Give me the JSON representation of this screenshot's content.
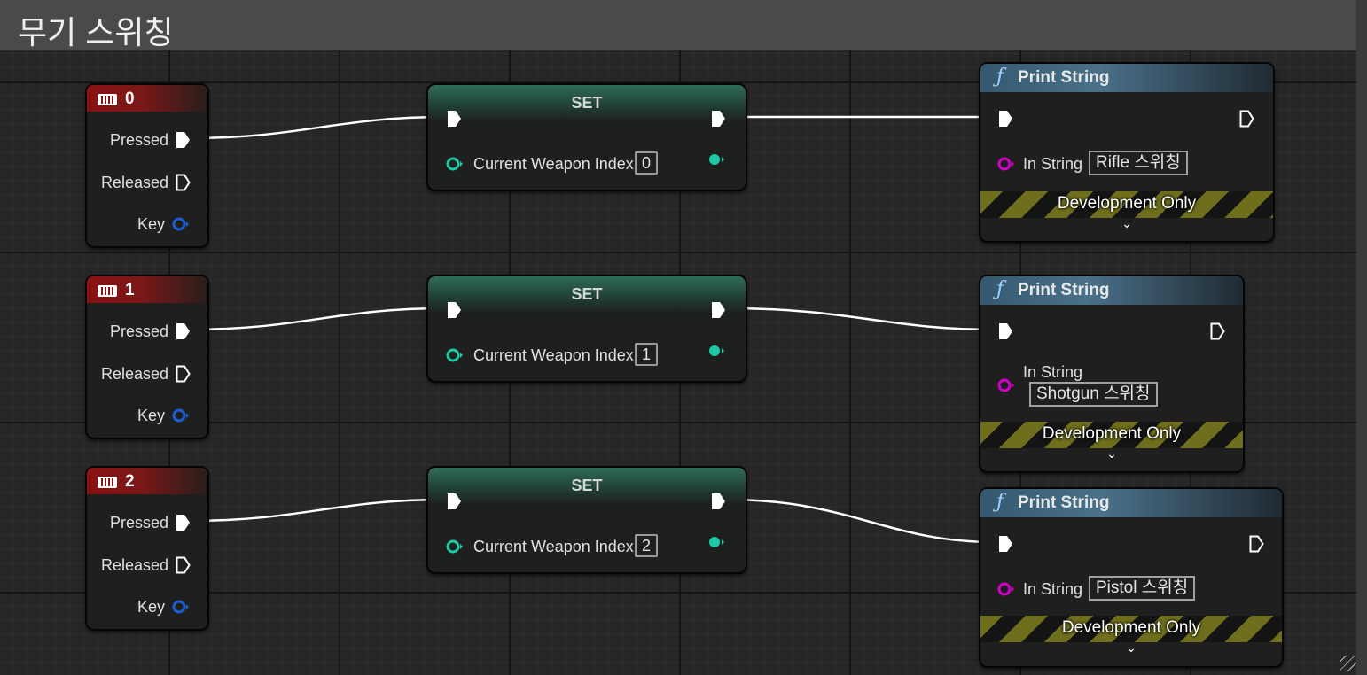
{
  "comment": {
    "title": "무기 스위칭"
  },
  "events": [
    {
      "key": "0",
      "pins": {
        "pressed": "Pressed",
        "released": "Released",
        "key": "Key"
      }
    },
    {
      "key": "1",
      "pins": {
        "pressed": "Pressed",
        "released": "Released",
        "key": "Key"
      }
    },
    {
      "key": "2",
      "pins": {
        "pressed": "Pressed",
        "released": "Released",
        "key": "Key"
      }
    }
  ],
  "set_nodes": [
    {
      "title": "SET",
      "variable": "Current Weapon Index",
      "value": "0"
    },
    {
      "title": "SET",
      "variable": "Current Weapon Index",
      "value": "1"
    },
    {
      "title": "SET",
      "variable": "Current Weapon Index",
      "value": "2"
    }
  ],
  "print_nodes": [
    {
      "title": "Print String",
      "in_string_label": "In String",
      "in_string_value": "Rifle 스위칭",
      "dev_label": "Development Only"
    },
    {
      "title": "Print String",
      "in_string_label": "In String",
      "in_string_value": "Shotgun 스위칭",
      "dev_label": "Development Only"
    },
    {
      "title": "Print String",
      "in_string_label": "In String",
      "in_string_value": "Pistol 스위칭",
      "dev_label": "Development Only"
    }
  ],
  "icons": {
    "function": "ƒ",
    "expand": "⌄",
    "keyboard": "keyboard-icon",
    "exec_pin": "exec-pin-icon",
    "data_pin": "data-pin-icon"
  },
  "colors": {
    "event_header": "#8a1212",
    "set_header": "#2f6b59",
    "print_header": "#4a718a",
    "int_pin": "#1fc9a5",
    "string_pin": "#d400c8",
    "key_pin": "#1a5fd6",
    "wire": "#ffffff"
  }
}
